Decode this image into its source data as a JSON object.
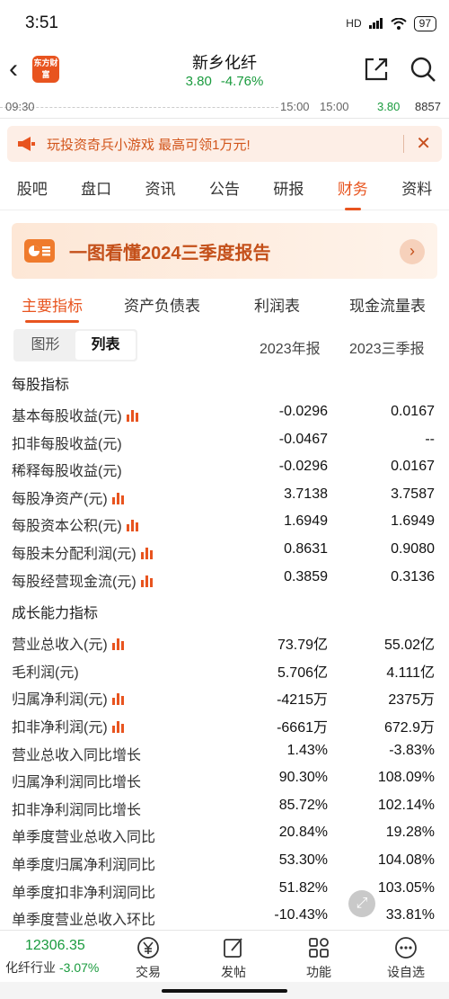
{
  "status": {
    "time": "3:51",
    "network": "HD",
    "battery": "97"
  },
  "header": {
    "stock_name": "新乡化纤",
    "price": "3.80",
    "change_pct": "-4.76%",
    "logo_text": "东方财富"
  },
  "mini_chart": {
    "start_time": "09:30",
    "end_time_1": "15:00",
    "end_time_2": "15:00",
    "price": "3.80",
    "volume": "8857"
  },
  "banner": {
    "text": "玩投资奇兵小游戏 最高可领1万元!"
  },
  "tabs": [
    "股吧",
    "盘口",
    "资讯",
    "公告",
    "研报",
    "财务",
    "资料"
  ],
  "report_card": {
    "title": "一图看懂2024三季度报告"
  },
  "subtabs": [
    "主要指标",
    "资产负债表",
    "利润表",
    "现金流量表"
  ],
  "view_toggle": {
    "chart": "图形",
    "list": "列表"
  },
  "columns": [
    "2023年报",
    "2023三季报"
  ],
  "sections": [
    {
      "title": "每股指标",
      "rows": [
        {
          "label": "基本每股收益(元)",
          "v1": "-0.0296",
          "v2": "0.0167",
          "chart": true
        },
        {
          "label": "扣非每股收益(元)",
          "v1": "-0.0467",
          "v2": "--",
          "chart": false
        },
        {
          "label": "稀释每股收益(元)",
          "v1": "-0.0296",
          "v2": "0.0167",
          "chart": false
        },
        {
          "label": "每股净资产(元)",
          "v1": "3.7138",
          "v2": "3.7587",
          "chart": true
        },
        {
          "label": "每股资本公积(元)",
          "v1": "1.6949",
          "v2": "1.6949",
          "chart": true
        },
        {
          "label": "每股未分配利润(元)",
          "v1": "0.8631",
          "v2": "0.9080",
          "chart": true
        },
        {
          "label": "每股经营现金流(元)",
          "v1": "0.3859",
          "v2": "0.3136",
          "chart": true
        }
      ]
    },
    {
      "title": "成长能力指标",
      "rows": [
        {
          "label": "营业总收入(元)",
          "v1": "73.79亿",
          "v2": "55.02亿",
          "chart": true
        },
        {
          "label": "毛利润(元)",
          "v1": "5.706亿",
          "v2": "4.111亿",
          "chart": false
        },
        {
          "label": "归属净利润(元)",
          "v1": "-4215万",
          "v2": "2375万",
          "chart": true
        },
        {
          "label": "扣非净利润(元)",
          "v1": "-6661万",
          "v2": "672.9万",
          "chart": true
        },
        {
          "label": "营业总收入同比增长",
          "v1": "1.43%",
          "v2": "-3.83%",
          "chart": false
        },
        {
          "label": "归属净利润同比增长",
          "v1": "90.30%",
          "v2": "108.09%",
          "chart": false
        },
        {
          "label": "扣非净利润同比增长",
          "v1": "85.72%",
          "v2": "102.14%",
          "chart": false
        },
        {
          "label": "单季度营业总收入同比",
          "v1": "20.84%",
          "v2": "19.28%",
          "chart": false
        },
        {
          "label": "单季度归属净利润同比",
          "v1": "53.30%",
          "v2": "104.08%",
          "chart": false
        },
        {
          "label": "单季度扣非净利润同比",
          "v1": "51.82%",
          "v2": "103.05%",
          "chart": false
        },
        {
          "label": "单季度营业总收入环比",
          "v1": "-10.43%",
          "v2": "33.81%",
          "chart": false
        }
      ]
    }
  ],
  "bottom": {
    "index_value": "12306.35",
    "index_name": "化纤行业",
    "index_change": "-3.07%",
    "nav": [
      "交易",
      "发帖",
      "功能",
      "设自选"
    ]
  },
  "colors": {
    "accent": "#e8541f",
    "down": "#1a9b3e"
  }
}
